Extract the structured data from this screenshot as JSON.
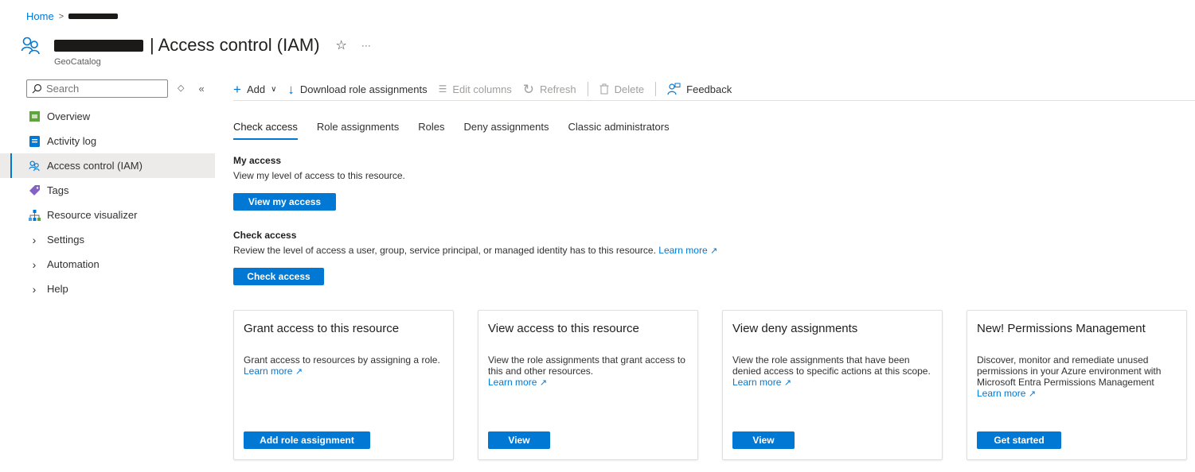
{
  "breadcrumb": {
    "home": "Home",
    "separator": ">"
  },
  "header": {
    "title": "| Access control (IAM)",
    "subtitle": "GeoCatalog",
    "favorite_icon": "☆",
    "more_icon": "···"
  },
  "sidebar": {
    "search_placeholder": "Search",
    "items": [
      {
        "label": "Overview",
        "icon": "overview-icon"
      },
      {
        "label": "Activity log",
        "icon": "activity-log-icon"
      },
      {
        "label": "Access control (IAM)",
        "icon": "iam-icon",
        "active": true
      },
      {
        "label": "Tags",
        "icon": "tag-icon"
      },
      {
        "label": "Resource visualizer",
        "icon": "resource-visualizer-icon"
      },
      {
        "label": "Settings",
        "icon": "chevron-right-icon"
      },
      {
        "label": "Automation",
        "icon": "chevron-right-icon"
      },
      {
        "label": "Help",
        "icon": "chevron-right-icon"
      }
    ]
  },
  "toolbar": {
    "add": "Add",
    "download": "Download role assignments",
    "edit_columns": "Edit columns",
    "refresh": "Refresh",
    "delete": "Delete",
    "feedback": "Feedback"
  },
  "tabs": [
    "Check access",
    "Role assignments",
    "Roles",
    "Deny assignments",
    "Classic administrators"
  ],
  "my_access": {
    "heading": "My access",
    "text": "View my level of access to this resource.",
    "button": "View my access"
  },
  "check_access": {
    "heading": "Check access",
    "text": "Review the level of access a user, group, service principal, or managed identity has to this resource.",
    "learn_more": "Learn more",
    "button": "Check access"
  },
  "cards": [
    {
      "title": "Grant access to this resource",
      "desc": "Grant access to resources by assigning a role.",
      "learn_more": "Learn more",
      "button": "Add role assignment"
    },
    {
      "title": "View access to this resource",
      "desc": "View the role assignments that grant access to this and other resources.",
      "learn_more": "Learn more",
      "button": "View"
    },
    {
      "title": "View deny assignments",
      "desc": "View the role assignments that have been denied access to specific actions at this scope.",
      "learn_more": "Learn more",
      "button": "View"
    },
    {
      "title": "New! Permissions Management",
      "desc": "Discover, monitor and remediate unused permissions in your Azure environment with Microsoft Entra Permissions Management",
      "learn_more": "Learn more",
      "button": "Get started"
    }
  ],
  "colors": {
    "accent": "#0078d4",
    "text": "#323130",
    "border": "#e1dfdd"
  }
}
